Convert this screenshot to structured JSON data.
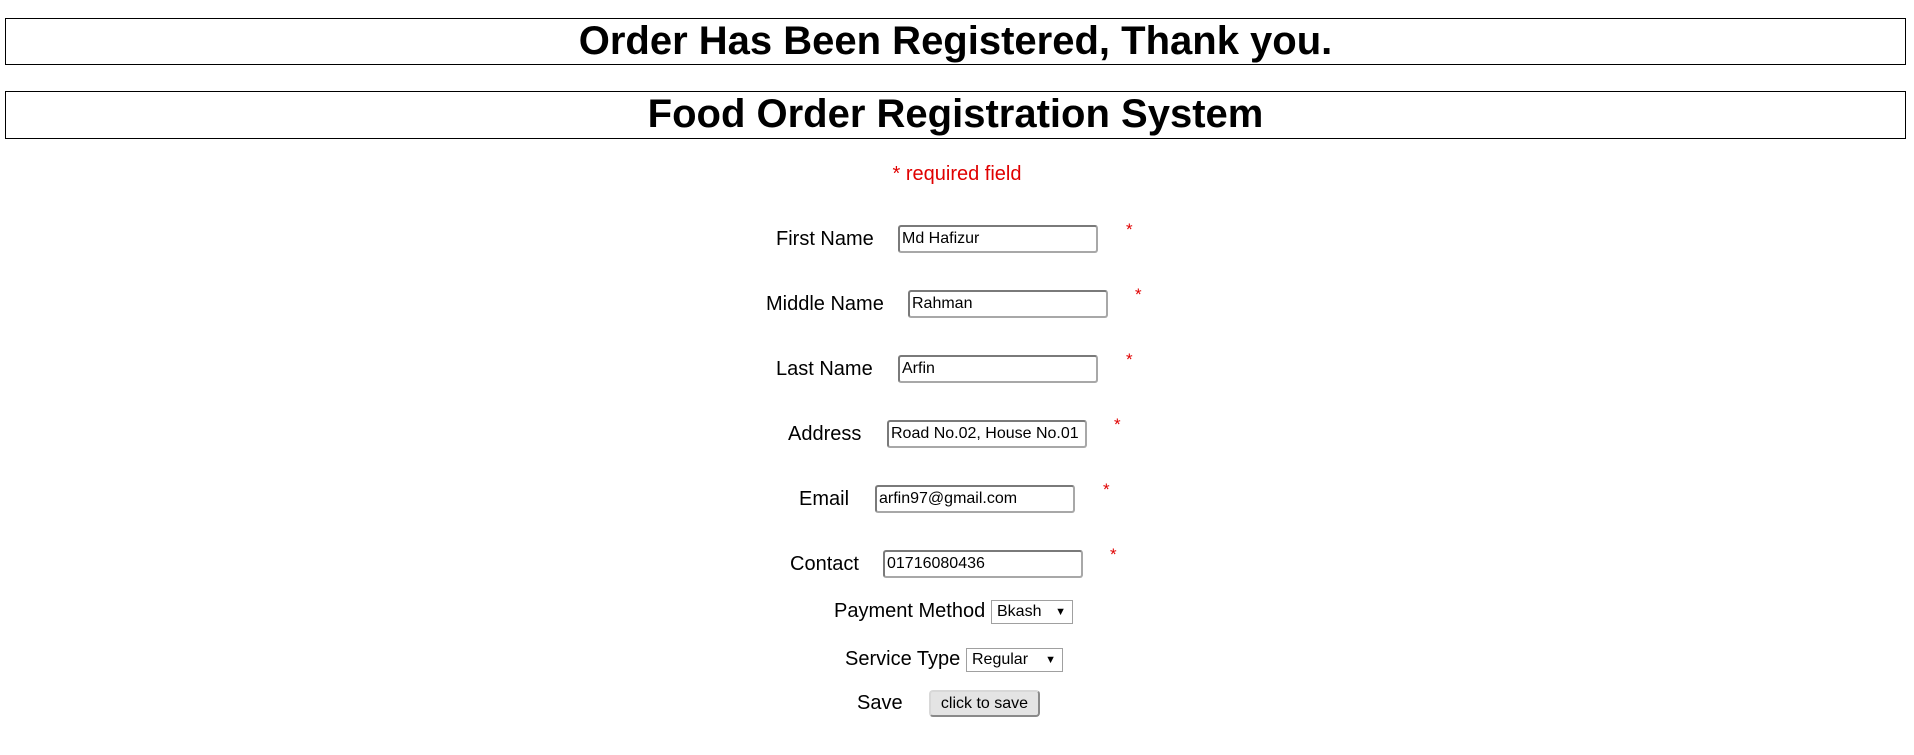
{
  "banner_message": "Order Has Been Registered, Thank you.",
  "page_title": "Food Order Registration System",
  "required_note": "* required field",
  "required_marker": "*",
  "fields": {
    "first_name": {
      "label": "First Name",
      "value": "Md Hafizur"
    },
    "middle_name": {
      "label": "Middle Name",
      "value": "Rahman"
    },
    "last_name": {
      "label": "Last Name",
      "value": "Arfin"
    },
    "address": {
      "label": "Address",
      "value": "Road No.02, House No.01"
    },
    "email": {
      "label": "Email",
      "value": "arfin97@gmail.com"
    },
    "contact": {
      "label": "Contact",
      "value": "01716080436"
    }
  },
  "payment_method": {
    "label": "Payment Method",
    "selected": "Bkash"
  },
  "service_type": {
    "label": "Service Type",
    "selected": "Regular"
  },
  "save": {
    "label": "Save",
    "button_label": "click to save"
  },
  "colors": {
    "required": "#e00000",
    "border": "#000000"
  }
}
